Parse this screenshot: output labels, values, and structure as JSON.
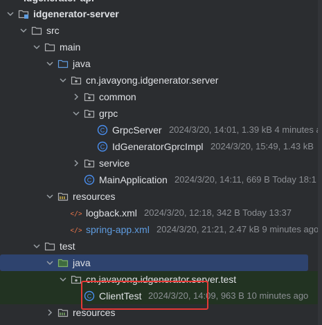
{
  "colors": {
    "background": "#2b2d30",
    "selection": "#2e436e",
    "text": "#dfe1e5",
    "meta_text": "#8c8f94",
    "blue_text": "#5f9ce0",
    "class_icon": "#4a8ff0",
    "annotation_box": "#e53935"
  },
  "tree": {
    "cutoff_label": "idgenerator-api",
    "items": [
      {
        "id": "idgenerator-server",
        "label": "idgenerator-server",
        "depth": 0,
        "expanded": true,
        "icon": "module-folder-icon",
        "bold": true,
        "meta": ""
      },
      {
        "id": "src",
        "label": "src",
        "depth": 1,
        "expanded": true,
        "icon": "folder-icon",
        "meta": ""
      },
      {
        "id": "main",
        "label": "main",
        "depth": 2,
        "expanded": true,
        "icon": "folder-icon",
        "meta": ""
      },
      {
        "id": "java-main",
        "label": "java",
        "depth": 3,
        "expanded": true,
        "icon": "source-folder-icon",
        "meta": ""
      },
      {
        "id": "pkg-server",
        "label": "cn.javayong.idgenerator.server",
        "depth": 4,
        "expanded": true,
        "icon": "package-icon",
        "meta": ""
      },
      {
        "id": "common",
        "label": "common",
        "depth": 5,
        "expanded": false,
        "icon": "package-icon",
        "meta": ""
      },
      {
        "id": "grpc",
        "label": "grpc",
        "depth": 5,
        "expanded": true,
        "icon": "package-icon",
        "meta": ""
      },
      {
        "id": "GrpcServer",
        "label": "GrpcServer",
        "depth": 6,
        "leaf": true,
        "icon": "class-icon",
        "meta": "2024/3/20, 14:01, 1.39 kB 4 minutes a"
      },
      {
        "id": "IdGeneratorGprcImpl",
        "label": "IdGeneratorGprcImpl",
        "depth": 6,
        "leaf": true,
        "icon": "class-icon",
        "meta": "2024/3/20, 15:49, 1.43 kB"
      },
      {
        "id": "service",
        "label": "service",
        "depth": 5,
        "expanded": false,
        "icon": "package-icon",
        "meta": ""
      },
      {
        "id": "MainApplication",
        "label": "MainApplication",
        "depth": 5,
        "leaf": true,
        "icon": "class-icon",
        "meta": "2024/3/20, 14:11, 669 B Today 18:1"
      },
      {
        "id": "resources-main",
        "label": "resources",
        "depth": 3,
        "expanded": true,
        "icon": "resources-folder-icon",
        "meta": ""
      },
      {
        "id": "logback",
        "label": "logback.xml",
        "depth": 4,
        "leaf": true,
        "icon": "xml-icon",
        "meta": "2024/3/20, 12:18, 342 B Today 13:37"
      },
      {
        "id": "spring-app",
        "label": "spring-app.xml",
        "depth": 4,
        "leaf": true,
        "icon": "xml-icon",
        "blue": true,
        "meta": "2024/3/20, 21:21, 2.47 kB 9 minutes ago"
      },
      {
        "id": "test",
        "label": "test",
        "depth": 2,
        "expanded": true,
        "icon": "folder-icon",
        "meta": ""
      },
      {
        "id": "java-test",
        "label": "java",
        "depth": 3,
        "expanded": true,
        "icon": "test-folder-icon",
        "selected": true,
        "meta": ""
      },
      {
        "id": "pkg-test",
        "label": "cn.javayong.idgenerator.server.test",
        "depth": 4,
        "expanded": true,
        "icon": "package-icon",
        "highlight": true,
        "meta": ""
      },
      {
        "id": "ClientTest",
        "label": "ClientTest",
        "depth": 5,
        "leaf": true,
        "icon": "class-icon",
        "highlight": true,
        "meta": "2024/3/20, 14:09, 963 B 10 minutes ago"
      },
      {
        "id": "resources-test",
        "label": "resources",
        "depth": 3,
        "expanded": false,
        "icon": "test-resources-folder-icon",
        "meta": ""
      }
    ]
  }
}
